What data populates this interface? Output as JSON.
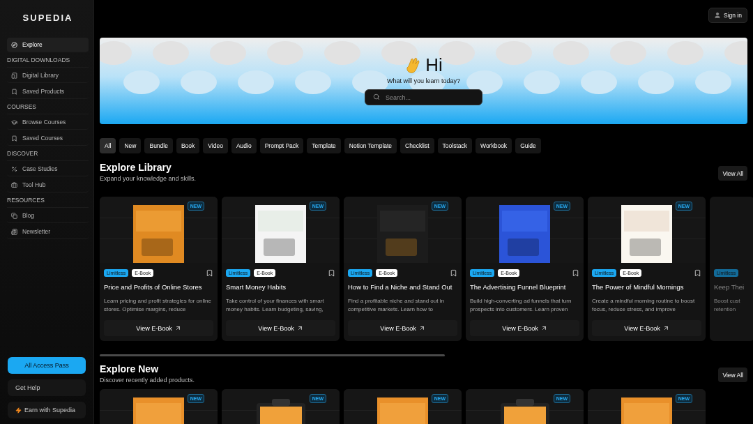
{
  "brand": "SUPEDIA",
  "sidebar": {
    "items": [
      {
        "kind": "link",
        "label": "Explore",
        "selected": true
      },
      {
        "kind": "heading",
        "label": "DIGITAL DOWNLOADS"
      },
      {
        "kind": "link",
        "label": "Digital Library",
        "selected": false
      },
      {
        "kind": "link",
        "label": "Saved Products",
        "selected": false
      },
      {
        "kind": "heading",
        "label": "COURSES"
      },
      {
        "kind": "link",
        "label": "Browse Courses",
        "selected": false
      },
      {
        "kind": "link",
        "label": "Saved Courses",
        "selected": false
      },
      {
        "kind": "heading",
        "label": "DISCOVER"
      },
      {
        "kind": "link",
        "label": "Case Studies",
        "selected": false
      },
      {
        "kind": "link",
        "label": "Tool Hub",
        "selected": false
      },
      {
        "kind": "heading",
        "label": "RESOURCES"
      },
      {
        "kind": "link",
        "label": "Blog",
        "selected": false
      },
      {
        "kind": "link",
        "label": "Newsletter",
        "selected": false
      }
    ],
    "buttons": [
      {
        "kind": "primary",
        "label": "All Access Pass"
      },
      {
        "kind": "plain",
        "label": "Get Help"
      },
      {
        "kind": "bolt",
        "label": "Earn with Supedia"
      }
    ]
  },
  "sign_in": "Sign in",
  "hero": {
    "greeting": "Hi",
    "subtitle": "What will you learn today?",
    "search": {
      "placeholder": "Search..."
    }
  },
  "filters": [
    {
      "label": "All",
      "selected": true
    },
    {
      "label": "New",
      "selected": false
    },
    {
      "label": "Bundle",
      "selected": false
    },
    {
      "label": "Book",
      "selected": false
    },
    {
      "label": "Video",
      "selected": false
    },
    {
      "label": "Audio",
      "selected": false
    },
    {
      "label": "Prompt Pack",
      "selected": false
    },
    {
      "label": "Template",
      "selected": false
    },
    {
      "label": "Notion Template",
      "selected": false
    },
    {
      "label": "Checklist",
      "selected": false
    },
    {
      "label": "Toolstack",
      "selected": false
    },
    {
      "label": "Workbook",
      "selected": false
    },
    {
      "label": "Guide",
      "selected": false
    }
  ],
  "sections": [
    {
      "title": "Explore Library",
      "subtitle": "Expand your knowledge and skills.",
      "view_all": "View All",
      "cards": [
        {
          "badge": "NEW",
          "tags": [
            "Limitless",
            "E-Book"
          ],
          "title": "Price and Profits of Online Stores",
          "description": "Learn pricing and profit strategies for online stores. Optimise margins, reduce",
          "button": "View E-Book"
        },
        {
          "badge": "NEW",
          "tags": [
            "Limitless",
            "E-Book"
          ],
          "title": "Smart Money Habits",
          "description": "Take control of your finances with smart money habits. Learn budgeting, saving,",
          "button": "View E-Book"
        },
        {
          "badge": "NEW",
          "tags": [
            "Limitless",
            "E-Book"
          ],
          "title": "How to Find a Niche and Stand Out",
          "description": "Find a profitable niche and stand out in competitive markets. Learn how to",
          "button": "View E-Book"
        },
        {
          "badge": "NEW",
          "tags": [
            "Limitless",
            "E-Book"
          ],
          "title": "The Advertising Funnel Blueprint",
          "description": "Build high-converting ad funnels that turn prospects into customers. Learn proven",
          "button": "View E-Book"
        },
        {
          "badge": "NEW",
          "tags": [
            "Limitless",
            "E-Book"
          ],
          "title": "The Power of Mindful Mornings",
          "description": "Create a mindful morning routine to boost focus, reduce stress, and improve",
          "button": "View E-Book"
        },
        {
          "tags": [
            "Limitless"
          ],
          "title": "Keep Thei",
          "description": "Boost cust retention"
        }
      ]
    },
    {
      "title": "Explore New",
      "subtitle": "Discover recently added products.",
      "view_all": "View All",
      "cards": [
        {
          "badge": "NEW"
        },
        {
          "badge": "NEW"
        },
        {
          "badge": "NEW"
        },
        {
          "badge": "NEW"
        },
        {
          "badge": "NEW"
        }
      ]
    }
  ]
}
